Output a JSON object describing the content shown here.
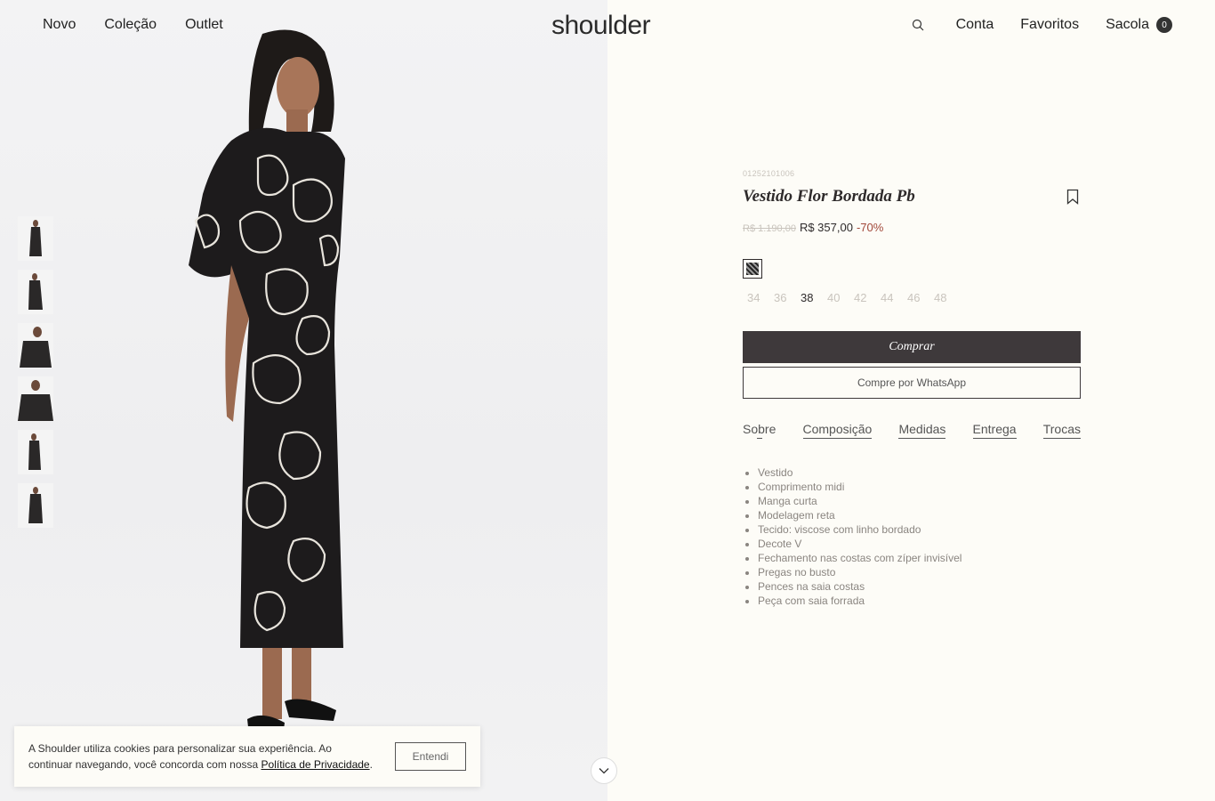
{
  "header": {
    "nav_left": [
      "Novo",
      "Coleção",
      "Outlet"
    ],
    "logo": "shoulder",
    "account": "Conta",
    "favorites": "Favoritos",
    "bag": "Sacola",
    "bag_count": "0"
  },
  "product": {
    "sku": "01252101006",
    "title": "Vestido Flor Bordada Pb",
    "old_price": "R$ 1.190,00",
    "price": "R$ 357,00",
    "discount": "-70%",
    "sizes": [
      "34",
      "36",
      "38",
      "40",
      "42",
      "44",
      "46",
      "48"
    ],
    "selected_size": "38",
    "buy_label": "Comprar",
    "whatsapp_label": "Compre por WhatsApp",
    "tabs": [
      "Sobre",
      "Composição",
      "Medidas",
      "Entrega",
      "Trocas"
    ],
    "active_tab": "Sobre",
    "details": [
      "Vestido",
      "Comprimento midi",
      "Manga curta",
      "Modelagem reta",
      "Tecido: viscose com linho bordado",
      "Decote V",
      "Fechamento nas costas com zíper invisível",
      "Pregas no busto",
      "Pences na saia costas",
      "Peça com saia forrada"
    ]
  },
  "gallery": {
    "thumbnail_count": 6
  },
  "cookie": {
    "text": "A Shoulder utiliza cookies para personalizar sua experiência. Ao continuar navegando, você concorda com nossa",
    "link": "Política de Privacidade",
    "suffix": ".",
    "button": "Entendi"
  }
}
